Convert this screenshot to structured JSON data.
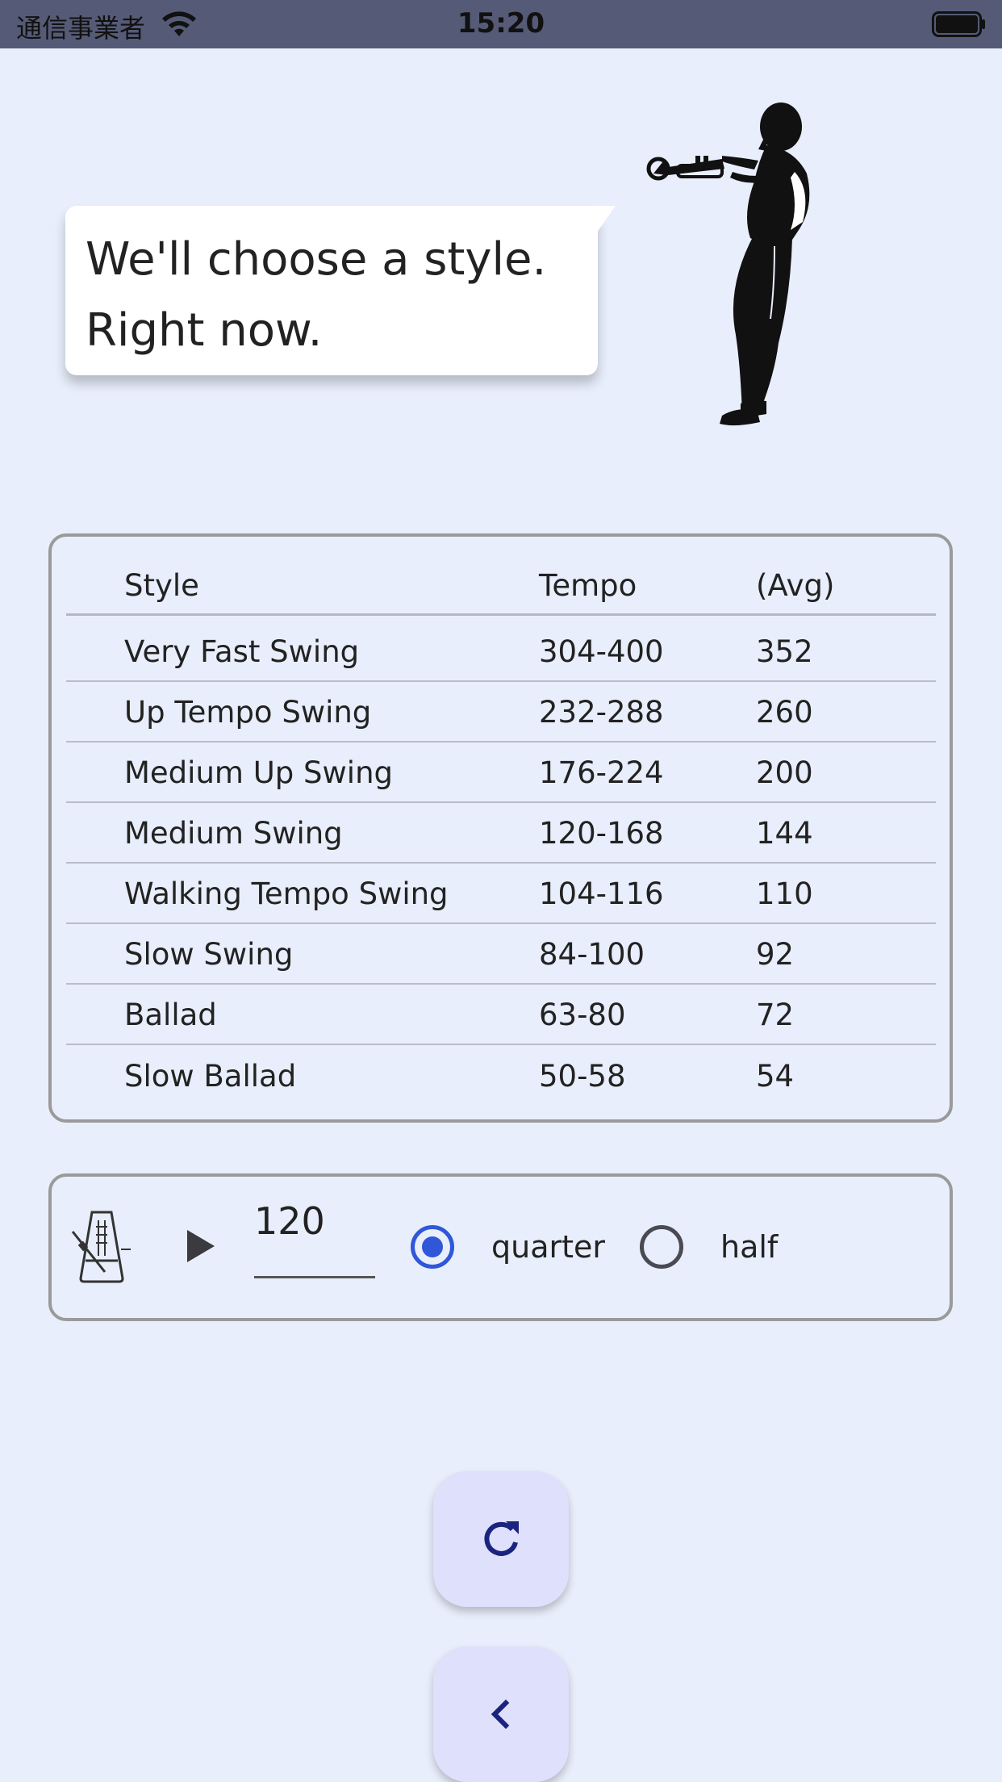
{
  "status_bar": {
    "carrier": "通信事業者",
    "time": "15:20"
  },
  "speech": {
    "line1": "We'll choose a style.",
    "line2": "Right now."
  },
  "table": {
    "headers": {
      "style": "Style",
      "tempo": "Tempo",
      "avg": "(Avg)"
    },
    "rows": [
      {
        "style": "Very Fast Swing",
        "tempo": "304-400",
        "avg": "352"
      },
      {
        "style": "Up Tempo Swing",
        "tempo": "232-288",
        "avg": "260"
      },
      {
        "style": "Medium Up Swing",
        "tempo": "176-224",
        "avg": "200"
      },
      {
        "style": "Medium Swing",
        "tempo": "120-168",
        "avg": "144"
      },
      {
        "style": "Walking Tempo Swing",
        "tempo": "104-116",
        "avg": "110"
      },
      {
        "style": "Slow Swing",
        "tempo": "84-100",
        "avg": "92"
      },
      {
        "style": "Ballad",
        "tempo": "63-80",
        "avg": "72"
      },
      {
        "style": "Slow Ballad",
        "tempo": "50-58",
        "avg": "54"
      }
    ]
  },
  "metronome": {
    "bpm": "120",
    "options": [
      {
        "label": "quarter",
        "selected": true
      },
      {
        "label": "half",
        "selected": false
      }
    ],
    "icons": {
      "metronome": "metronome-icon",
      "play": "play-icon"
    }
  },
  "actions": {
    "refresh_icon": "refresh-icon",
    "back_icon": "chevron-left-icon"
  },
  "colors": {
    "background": "#e8eefb",
    "status_bar": "#555b76",
    "accent": "#2f57d8",
    "fab": "#dfe0fb",
    "fab_icon": "#1a237e"
  }
}
